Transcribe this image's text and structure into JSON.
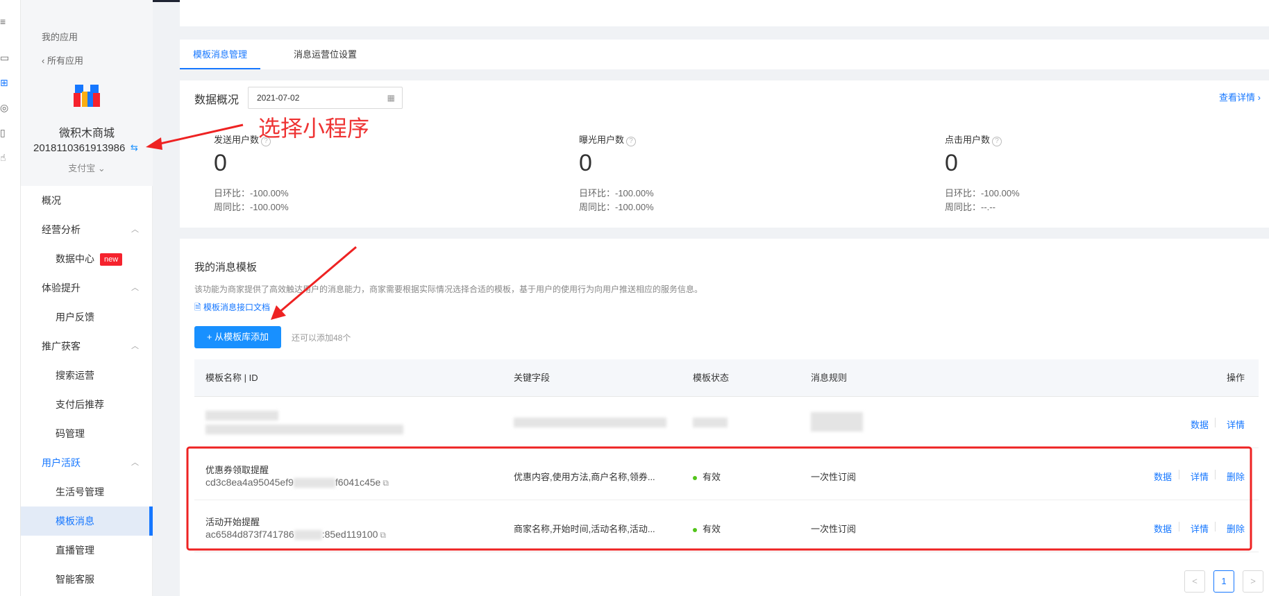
{
  "rail": {
    "menu_icon": "≡",
    "icons": [
      "monitor-icon",
      "apps-icon",
      "search-analytics-icon",
      "device-icon",
      "thumb-up-icon"
    ]
  },
  "sidebar": {
    "my_app": "我的应用",
    "all_apps": "所有应用",
    "app_name": "微积木商城",
    "app_id": "2018110361913986",
    "platform": "支付宝",
    "nav": [
      {
        "label": "概况"
      },
      {
        "label": "经营分析"
      },
      {
        "label": "数据中心",
        "badge": "new"
      },
      {
        "label": "体验提升"
      },
      {
        "label": "用户反馈"
      },
      {
        "label": "推广获客"
      },
      {
        "label": "搜索运营"
      },
      {
        "label": "支付后推荐"
      },
      {
        "label": "码管理"
      },
      {
        "label": "用户活跃"
      },
      {
        "label": "生活号管理"
      },
      {
        "label": "模板消息"
      },
      {
        "label": "直播管理"
      },
      {
        "label": "智能客服"
      }
    ]
  },
  "tabs": [
    "模板消息管理",
    "消息运营位设置"
  ],
  "overview": {
    "title": "数据概况",
    "date": "2021-07-02",
    "detail_link": "查看详情",
    "metrics": [
      {
        "label": "发送用户数",
        "value": "0",
        "day_ratio": "日环比：-100.00%",
        "week_ratio": "周同比：-100.00%"
      },
      {
        "label": "曝光用户数",
        "value": "0",
        "day_ratio": "日环比：-100.00%",
        "week_ratio": "周同比：-100.00%"
      },
      {
        "label": "点击用户数",
        "value": "0",
        "day_ratio": "日环比：-100.00%",
        "week_ratio": "周同比：--.--"
      }
    ]
  },
  "annotation": {
    "text": "选择小程序",
    "color": "#ee3333"
  },
  "templates": {
    "title": "我的消息模板",
    "description": "该功能为商家提供了高效触达用户的消息能力，商家需要根据实际情况选择合适的模板，基于用户的使用行为向用户推送相应的服务信息。",
    "doc_link": "模板消息接口文档",
    "add_button": "+ 从模板库添加",
    "remaining": "还可以添加48个",
    "columns": [
      "模板名称 | ID",
      "关键字段",
      "模板状态",
      "消息规则",
      "操作"
    ],
    "rows": [
      {
        "name": "",
        "id": "",
        "fields": "",
        "status": "",
        "rule": "",
        "ops": [
          "数据",
          "详情"
        ]
      },
      {
        "name": "优惠券领取提醒",
        "id": "cd3c8ea4a95045ef9",
        "id_tail": "f6041c45e",
        "fields": "优惠内容,使用方法,商户名称,领券...",
        "status": "有效",
        "rule": "一次性订阅",
        "ops": [
          "数据",
          "详情",
          "删除"
        ]
      },
      {
        "name": "活动开始提醒",
        "id": "ac6584d873f741786",
        "id_tail": ":85ed119100",
        "fields": "商家名称,开始时间,活动名称,活动...",
        "status": "有效",
        "rule": "一次性订阅",
        "ops": [
          "数据",
          "详情",
          "删除"
        ]
      }
    ]
  },
  "pagination": {
    "prev": "<",
    "current": "1",
    "next": ">"
  },
  "colors": {
    "primary": "#1677ff",
    "button": "#1890ff",
    "annotation": "#ee3333",
    "status_ok": "#52c41a"
  }
}
